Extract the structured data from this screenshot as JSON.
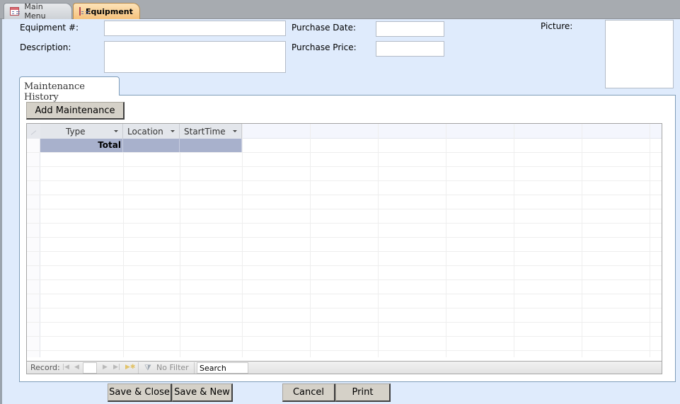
{
  "tabs": [
    {
      "label": "Main Menu",
      "active": false,
      "icon": "form-icon"
    },
    {
      "label": "Equipment",
      "active": true,
      "icon": "form-icon"
    }
  ],
  "form": {
    "equipment_number": {
      "label": "Equipment #:",
      "value": ""
    },
    "description": {
      "label": "Description:",
      "value": ""
    },
    "purchase_date": {
      "label": "Purchase Date:",
      "value": ""
    },
    "purchase_price": {
      "label": "Purchase Price:",
      "value": ""
    },
    "picture": {
      "label": "Picture:"
    }
  },
  "subform": {
    "tab_label": "Maintenance History",
    "add_button": "Add Maintenance",
    "columns": [
      {
        "label": "Type"
      },
      {
        "label": "Location"
      },
      {
        "label": "StartTime"
      }
    ],
    "total_row": {
      "label": "Total"
    },
    "rows": [],
    "navigation": {
      "record_label": "Record:",
      "record_value": "",
      "filter_label": "No Filter",
      "search_label": "Search",
      "first_icon": "first-record-icon",
      "prev_icon": "previous-record-icon",
      "next_icon": "next-record-icon",
      "last_icon": "last-record-icon",
      "new_icon": "new-record-icon"
    }
  },
  "buttons": {
    "save_close": "Save & Close",
    "save_new": "Save & New",
    "cancel": "Cancel",
    "print": "Print"
  },
  "colors": {
    "form_background": "#dfebfc",
    "active_tab": "#f6c27c",
    "total_row": "#a8b1cc",
    "button_face": "#d5d1c8"
  }
}
